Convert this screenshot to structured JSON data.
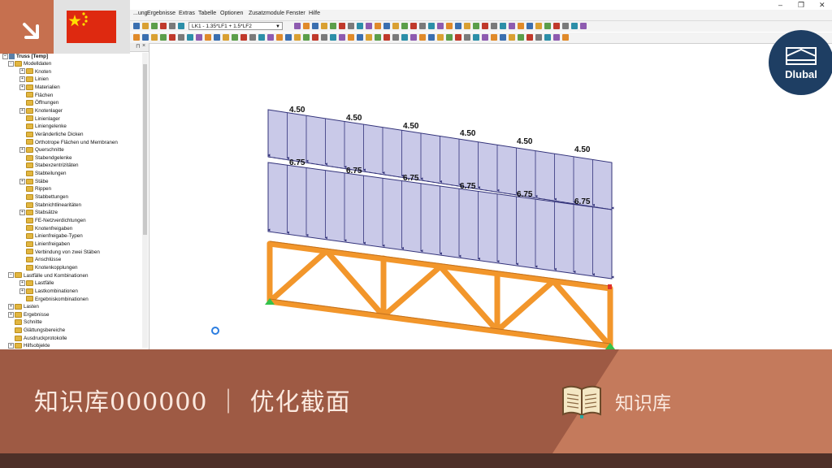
{
  "menu": {
    "items": [
      "...ung",
      "Ergebnisse",
      "Extras",
      "Tabelle",
      "Optionen",
      "Zusatzmodule",
      "Fenster",
      "Hilfe"
    ]
  },
  "toolbar": {
    "load_combo_value": "LK1 - 1.35*LF1 + 1.5*LF2"
  },
  "navigator": {
    "root_label": "Truss [Temp]",
    "items": [
      {
        "label": "Modelldaten",
        "expanded": true
      },
      {
        "label": "Knoten"
      },
      {
        "label": "Linien"
      },
      {
        "label": "Materialien"
      },
      {
        "label": "Flächen"
      },
      {
        "label": "Öffnungen"
      },
      {
        "label": "Knotenlager"
      },
      {
        "label": "Linienlager"
      },
      {
        "label": "Liniengelenke"
      },
      {
        "label": "Veränderliche Dicken"
      },
      {
        "label": "Orthotrope Flächen und Membranen"
      },
      {
        "label": "Querschnitte"
      },
      {
        "label": "Stabendgelenke"
      },
      {
        "label": "Stabexzentrizitäten"
      },
      {
        "label": "Stabteilungen"
      },
      {
        "label": "Stäbe"
      },
      {
        "label": "Rippen"
      },
      {
        "label": "Stabbettungen"
      },
      {
        "label": "Stabnichtlinearitäten"
      },
      {
        "label": "Stabsätze"
      },
      {
        "label": "FE-Netzverdichtungen"
      },
      {
        "label": "Knotenfreigaben"
      },
      {
        "label": "Linienfreigabe-Typen"
      },
      {
        "label": "Linienfreigaben"
      },
      {
        "label": "Verbindung von zwei Stäben"
      },
      {
        "label": "Anschlüsse"
      },
      {
        "label": "Knotenkopplungen"
      },
      {
        "label": "Lastfälle und Kombinationen",
        "expanded": true
      },
      {
        "label": "Lastfälle"
      },
      {
        "label": "Lastkombinationen"
      },
      {
        "label": "Ergebniskombinationen"
      },
      {
        "label": "Lasten"
      },
      {
        "label": "Ergebnisse"
      },
      {
        "label": "Schnitte"
      },
      {
        "label": "Glättungsbereiche"
      },
      {
        "label": "Ausdruckprotokolle"
      },
      {
        "label": "Hilfsobjekte"
      }
    ]
  },
  "loads": {
    "top_value_labels": [
      "4.50",
      "4.50",
      "4.50",
      "4.50",
      "4.50",
      "4.50"
    ],
    "bottom_value_labels": [
      "6.75",
      "6.75",
      "6.75",
      "6.75",
      "6.75",
      "6.75"
    ]
  },
  "banner": {
    "title": "知识库000000 ｜ 优化截面",
    "knowledge_base_label": "知识库"
  },
  "logo": {
    "text": "Dlubal"
  },
  "colors": {
    "banner": "#c47a5c",
    "banner_dark": "#9e5a44",
    "strip": "#4e3028",
    "truss": "#f2962b",
    "load_fill": "#c9c9e8",
    "logo_bg": "#1e3e63"
  }
}
